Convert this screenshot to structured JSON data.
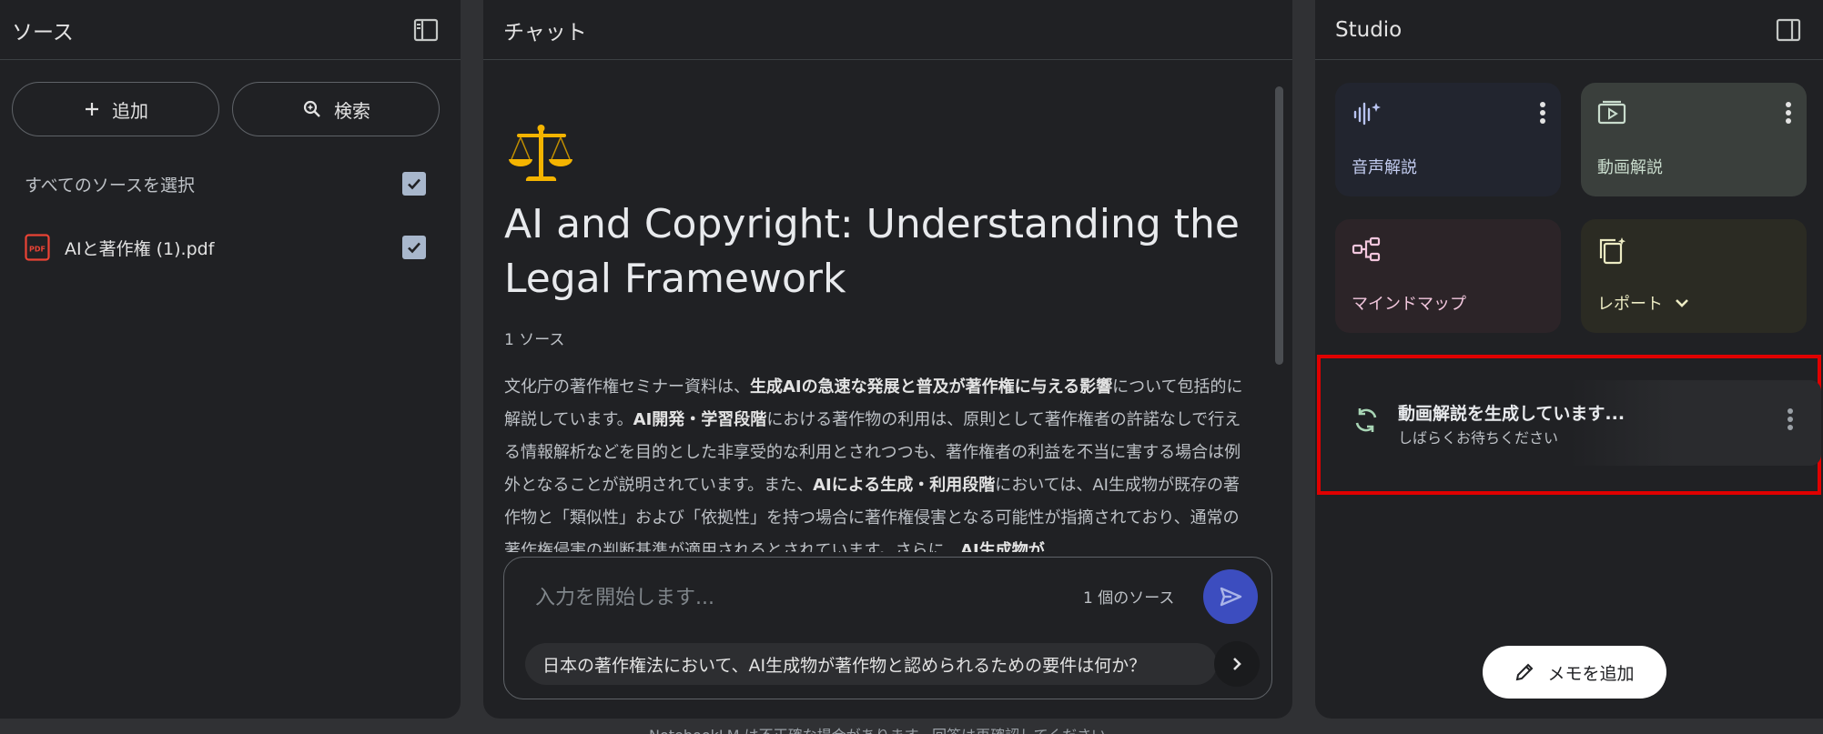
{
  "sources": {
    "title": "ソース",
    "add_label": "追加",
    "search_label": "検索",
    "select_all_label": "すべてのソースを選択",
    "files": [
      {
        "name": "AIと著作権 (1).pdf",
        "checked": true
      }
    ]
  },
  "chat": {
    "title": "チャット",
    "heading": "AI and Copyright: Understanding the Legal Framework",
    "source_count": "1 ソース",
    "summary_parts": [
      {
        "text": "文化庁の著作権セミナー資料は、",
        "bold": false
      },
      {
        "text": "生成AIの急速な発展と普及が著作権に与える影響",
        "bold": true
      },
      {
        "text": "について包括的に解説しています。",
        "bold": false
      },
      {
        "text": "AI開発・学習段階",
        "bold": true
      },
      {
        "text": "における著作物の利用は、原則として著作権者の許諾なしで行える情報解析などを目的とした非享受的な利用とされつつも、著作権者の利益を不当に害する場合は例外となることが説明されています。また、",
        "bold": false
      },
      {
        "text": "AIによる生成・利用段階",
        "bold": true
      },
      {
        "text": "においては、AI生成物が既存の著作物と「類似性」および「依拠性」を持つ場合に著作権侵害となる可能性が指摘されており、通常の著作権侵害の判断基準が適用されるとされています。さらに、",
        "bold": false
      },
      {
        "text": "AI生成物が",
        "bold": true
      }
    ],
    "input_placeholder": "入力を開始します...",
    "input_source_count": "1 個のソース",
    "suggestion": "日本の著作権法において、AI生成物が著作物と認められるための要件は何か？",
    "disclaimer": "NotebookLM は不正確な場合があります。回答は再確認してください。"
  },
  "studio": {
    "title": "Studio",
    "tiles": {
      "audio": "音声解説",
      "video": "動画解説",
      "mindmap": "マインドマップ",
      "report": "レポート"
    },
    "generating_title": "動画解説を生成しています...",
    "generating_subtitle": "しばらくお待ちください",
    "add_note_label": "メモを追加"
  },
  "colors": {
    "highlight_border": "#e00000",
    "send_button": "#3c4dbf"
  }
}
